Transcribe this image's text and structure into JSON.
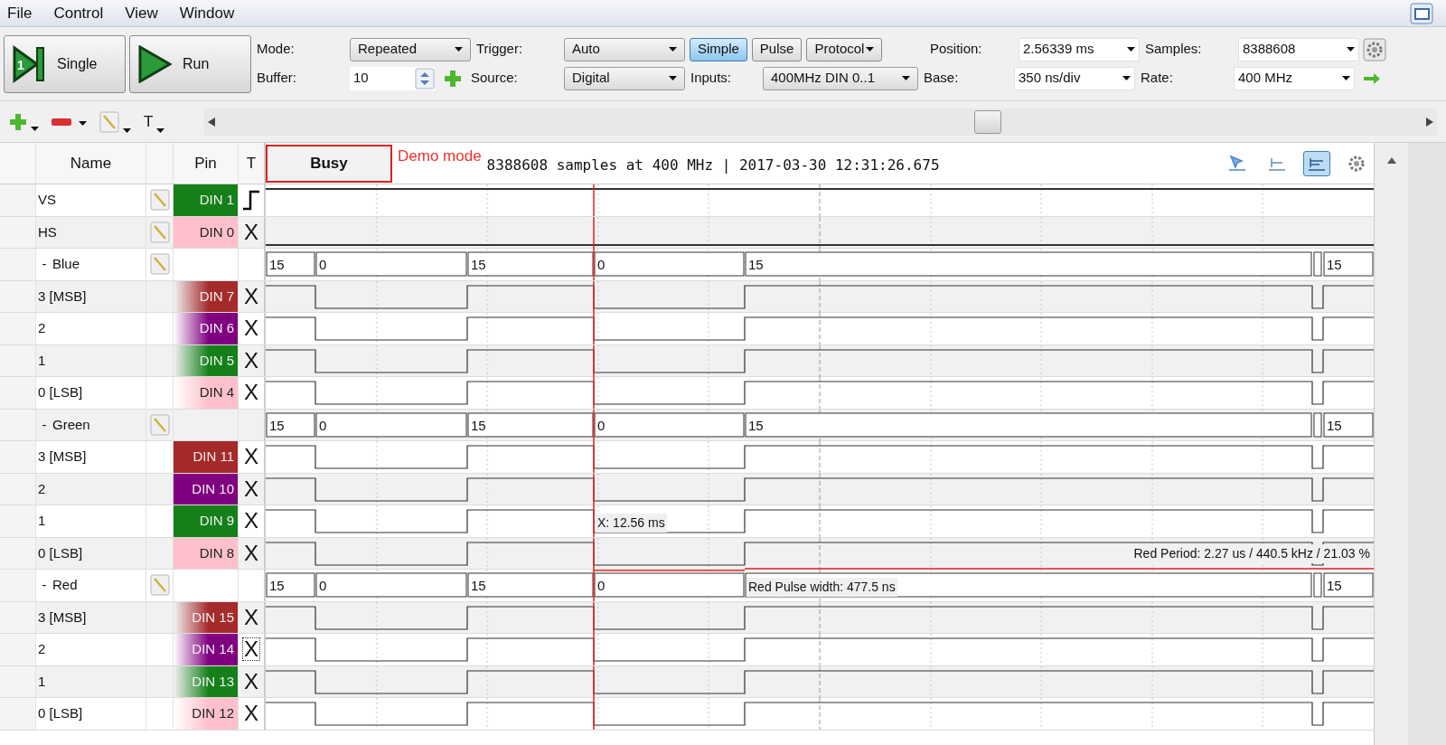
{
  "menu": [
    "File",
    "Control",
    "View",
    "Window"
  ],
  "toolbar": {
    "buttons": [
      {
        "label": "Single",
        "kind": "single",
        "icon_text": "1"
      },
      {
        "label": "Run",
        "kind": "run"
      }
    ],
    "mode": {
      "label": "Mode:",
      "value": "Repeated"
    },
    "buffer": {
      "label": "Buffer:",
      "value": "10"
    },
    "trigger": {
      "label": "Trigger:",
      "value": "Auto"
    },
    "source": {
      "label": "Source:",
      "value": "Digital"
    },
    "trigger_types": [
      {
        "label": "Simple",
        "selected": true,
        "menu": false
      },
      {
        "label": "Pulse",
        "selected": false,
        "menu": false
      },
      {
        "label": "Protocol",
        "selected": false,
        "menu": true
      }
    ],
    "inputs": {
      "label": "Inputs:",
      "value": "400MHz DIN 0..1"
    },
    "position": {
      "label": "Position:",
      "value": "2.56339 ms"
    },
    "base": {
      "label": "Base:",
      "value": "350 ns/div"
    },
    "samples": {
      "label": "Samples:",
      "value": "8388608"
    },
    "rate": {
      "label": "Rate:",
      "value": "400 MHz"
    }
  },
  "signal_toolbar": {
    "text_tool": "T"
  },
  "table": {
    "columns": [
      "Name",
      "Pin",
      "T"
    ],
    "busy": "Busy",
    "demo": "Demo mode",
    "status": "8388608 samples at 400 MHz | 2017-03-30 12:31:26.675",
    "view_tools": [
      {
        "kind": "pointer",
        "selected": false
      },
      {
        "kind": "marker",
        "selected": false
      },
      {
        "kind": "ruler",
        "selected": true
      },
      {
        "kind": "gear",
        "selected": false
      }
    ],
    "rows": [
      {
        "kind": "signal",
        "name": "VS",
        "pin": "DIN 1",
        "color": "#15801a",
        "faded": false,
        "trigger_edge": true,
        "edit_button": true,
        "high": true
      },
      {
        "kind": "signal",
        "name": "HS",
        "pin": "DIN 0",
        "color": "#ffc0cb",
        "faded": false,
        "trigger_edge": false,
        "trigger": "X",
        "edit_button": true,
        "focused": false,
        "high": false
      },
      {
        "kind": "group",
        "name": "Blue",
        "expander": "-",
        "expanded": true,
        "edit_button": true,
        "values": [
          "15",
          "0",
          "15",
          "0",
          "15",
          "15"
        ],
        "children": [
          {
            "kind": "bit",
            "name": "3 [MSB]",
            "pin": "DIN 7",
            "color": "#a52a2a",
            "faded": true,
            "trigger_edge": false,
            "trigger": "X",
            "focused": false
          },
          {
            "kind": "bit",
            "name": "2",
            "pin": "DIN 6",
            "color": "#800080",
            "faded": true,
            "trigger_edge": false,
            "trigger": "X",
            "focused": false
          },
          {
            "kind": "bit",
            "name": "1",
            "pin": "DIN 5",
            "color": "#15801a",
            "faded": true,
            "trigger_edge": false,
            "trigger": "X",
            "focused": false
          },
          {
            "kind": "bit",
            "name": "0 [LSB]",
            "pin": "DIN 4",
            "color": "#ffc0cb",
            "faded": true,
            "trigger_edge": false,
            "trigger": "X",
            "focused": false
          }
        ]
      },
      {
        "kind": "group",
        "name": "Green",
        "expander": "-",
        "expanded": true,
        "edit_button": true,
        "values": [
          "15",
          "0",
          "15",
          "0",
          "15",
          "15"
        ],
        "children": [
          {
            "kind": "bit",
            "name": "3 [MSB]",
            "pin": "DIN 11",
            "color": "#a52a2a",
            "faded": false,
            "trigger_edge": false,
            "trigger": "X",
            "focused": false
          },
          {
            "kind": "bit",
            "name": "2",
            "pin": "DIN 10",
            "color": "#800080",
            "faded": false,
            "trigger_edge": false,
            "trigger": "X",
            "focused": false
          },
          {
            "kind": "bit",
            "name": "1",
            "pin": "DIN 9",
            "color": "#15801a",
            "faded": false,
            "trigger_edge": false,
            "trigger": "X",
            "focused": false,
            "annotation": "X: 12.56 ms"
          },
          {
            "kind": "bit",
            "name": "0 [LSB]",
            "pin": "DIN 8",
            "color": "#ffc0cb",
            "faded": false,
            "trigger_edge": false,
            "trigger": "X",
            "focused": false,
            "annotation_right": "Red Period: 2.27 us / 440.5 kHz / 21.03 %"
          }
        ]
      },
      {
        "kind": "group",
        "name": "Red",
        "expander": "-",
        "expanded": true,
        "edit_button": true,
        "values": [
          "15",
          "0",
          "15",
          "0",
          "15"
        ],
        "annotation": "Red Pulse width: 477.5 ns",
        "children": [
          {
            "kind": "bit",
            "name": "3 [MSB]",
            "pin": "DIN 15",
            "color": "#a52a2a",
            "faded": true,
            "trigger_edge": false,
            "trigger": "X",
            "focused": false
          },
          {
            "kind": "bit",
            "name": "2",
            "pin": "DIN 14",
            "color": "#800080",
            "faded": true,
            "trigger_edge": false,
            "trigger": "X",
            "focused": true
          },
          {
            "kind": "bit",
            "name": "1",
            "pin": "DIN 13",
            "color": "#15801a",
            "faded": true,
            "trigger_edge": false,
            "trigger": "X",
            "focused": false
          },
          {
            "kind": "bit",
            "name": "0 [LSB]",
            "pin": "DIN 12",
            "color": "#ffc0cb",
            "faded": true,
            "trigger_edge": false,
            "trigger": "X",
            "focused": false
          }
        ]
      }
    ]
  }
}
